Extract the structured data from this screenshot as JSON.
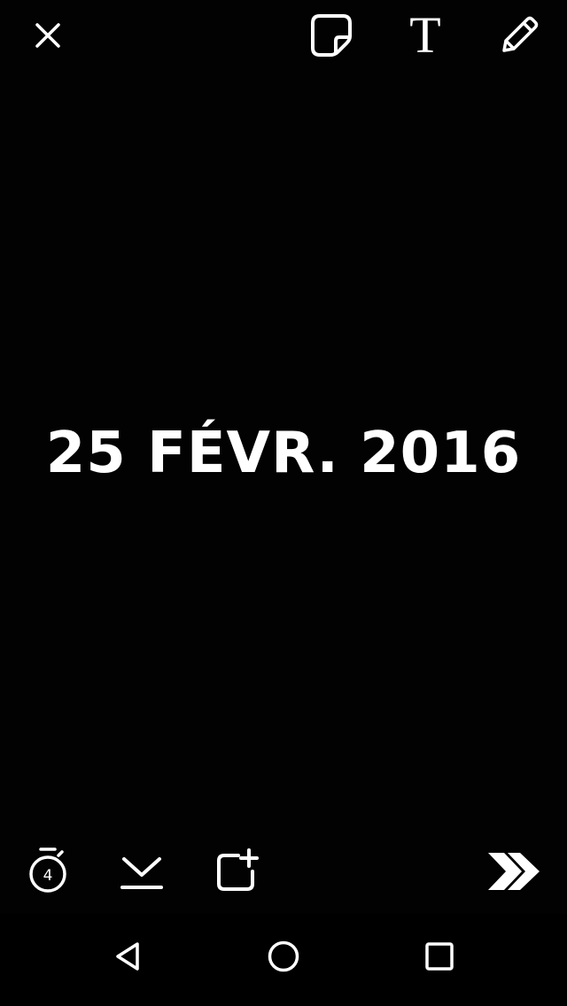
{
  "caption": {
    "date_text": "25 FÉVR. 2016"
  },
  "top_toolbar": {
    "icons": [
      "close-icon",
      "sticker-icon",
      "text-tool-icon",
      "pencil-icon"
    ],
    "text_tool_glyph": "T"
  },
  "bottom_toolbar": {
    "timer_seconds": "4",
    "icons": [
      "timer-icon",
      "download-icon",
      "add-to-story-icon",
      "send-arrow-icon"
    ]
  },
  "nav_bar": {
    "icons": [
      "back-triangle-icon",
      "home-circle-icon",
      "recents-square-icon"
    ]
  },
  "colors": {
    "background": "#020202",
    "foreground": "#ffffff",
    "nav_bar": "#000000"
  }
}
